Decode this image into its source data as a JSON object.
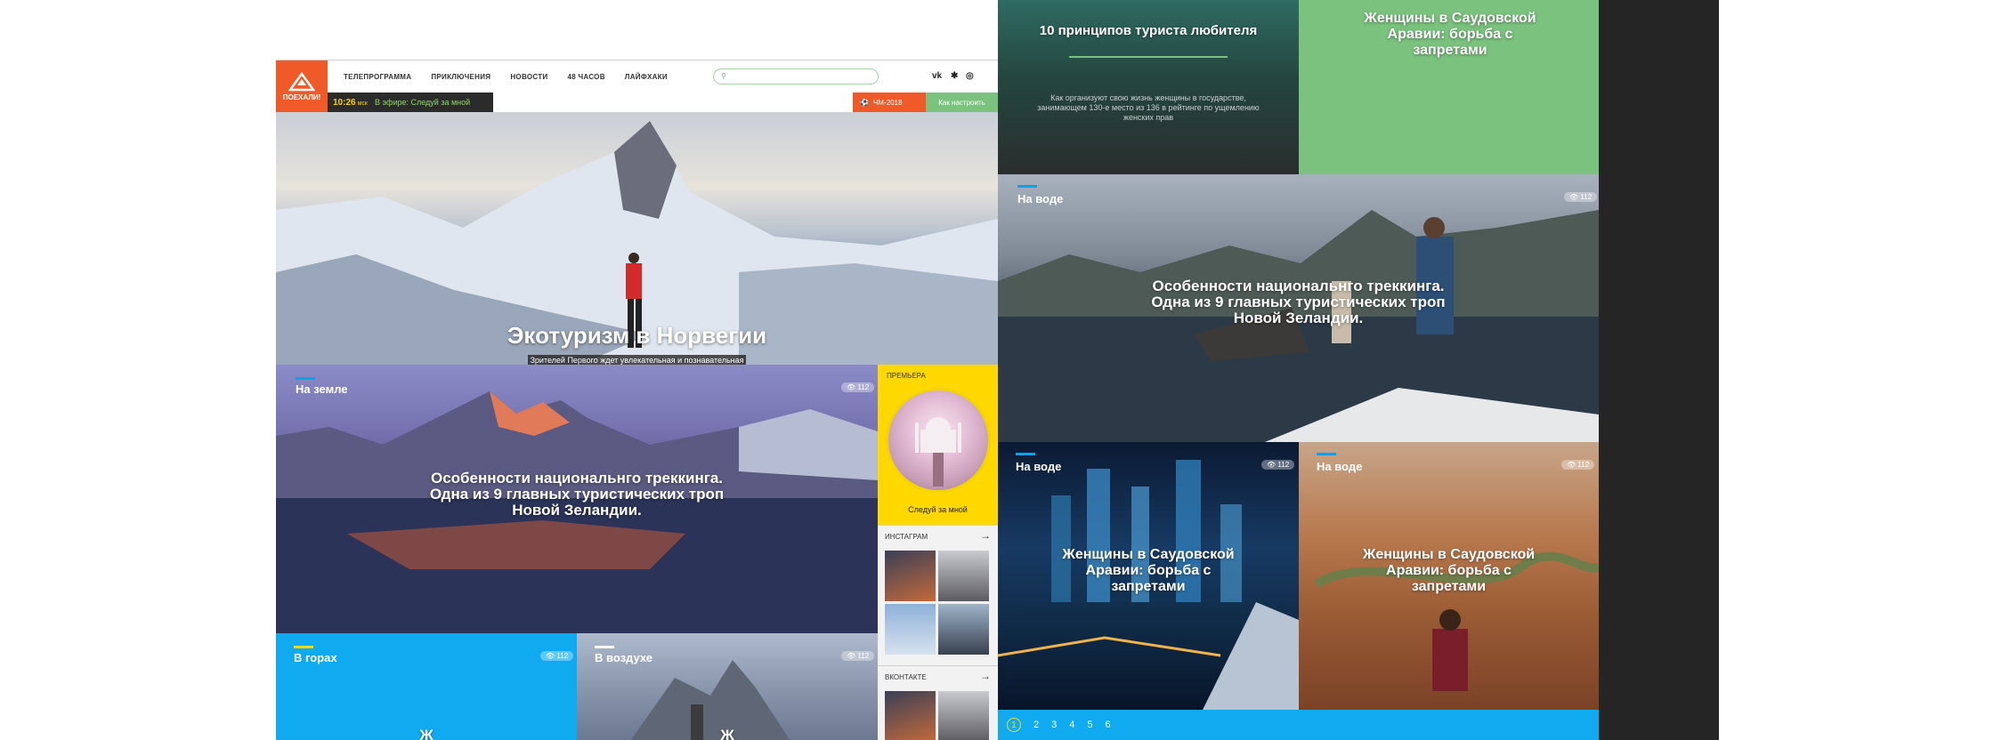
{
  "header": {
    "logo_text": "ПОЕХАЛИ!",
    "nav": [
      "ТЕЛЕПРОГРАММА",
      "ПРИКЛЮЧЕНИЯ",
      "НОВОСТИ",
      "48 ЧАСОВ",
      "ЛАЙФХАКИ"
    ],
    "search": {
      "placeholder": ""
    },
    "social": [
      "vk-icon",
      "ok-icon",
      "instagram-icon"
    ]
  },
  "onair": {
    "time": "10:26",
    "tz": "мск",
    "text": "В эфире: Следуй за мной"
  },
  "promo": {
    "chm_label": "ЧМ-2018",
    "tune_label": "Как настроить"
  },
  "hero": {
    "title": "Экотуризм в Норвегии",
    "description": "Зрителей Первого ждет увлекательная и познавательная программа о путешествиях, которая родилась из популярного Instagram-проекта FollowMe. Более четырех миллионов"
  },
  "tiles_left": [
    {
      "tag": "На земле",
      "views": "112",
      "title": "Особенности национальнго треккинга. Одна из 9 главных туристических троп Новой Зеландии."
    },
    {
      "tag": "В горах",
      "views": "112",
      "title": "Ж"
    },
    {
      "tag": "В воздухе",
      "views": "112",
      "title": "Ж"
    }
  ],
  "widgets": {
    "premier": {
      "label": "ПРЕМЬЕРА",
      "caption": "Следуй за мной"
    },
    "instagram": {
      "label": "ИНСТАГРАМ"
    },
    "vk": {
      "label": "ВКОНТАКТЕ"
    }
  },
  "right_top": [
    {
      "title": "10 принципов туриста любителя",
      "description": "Как организуют свою жизнь женщины в государстве, занимающем 130-е место из 136 в рейтинге по ущемлению женских прав"
    },
    {
      "title": "Женщины в Саудовской Аравии: борьба с запретами"
    }
  ],
  "right_tiles": [
    {
      "tag": "На воде",
      "views": "112",
      "title": "Особенности национальнго треккинга. Одна из 9 главных туристических троп Новой Зеландии."
    },
    {
      "tag": "На воде",
      "views": "112",
      "title": "Женщины в Саудовской Аравии: борьба с запретами"
    },
    {
      "tag": "На воде",
      "views": "112",
      "title": "Женщины в Саудовской Аравии: борьба с запретами"
    }
  ],
  "pagination": [
    "1",
    "2",
    "3",
    "4",
    "5",
    "6"
  ],
  "colors": {
    "accent": "#f05a28",
    "yellow": "#ffd800",
    "blue": "#10aaf0",
    "green": "#7ac27e"
  }
}
